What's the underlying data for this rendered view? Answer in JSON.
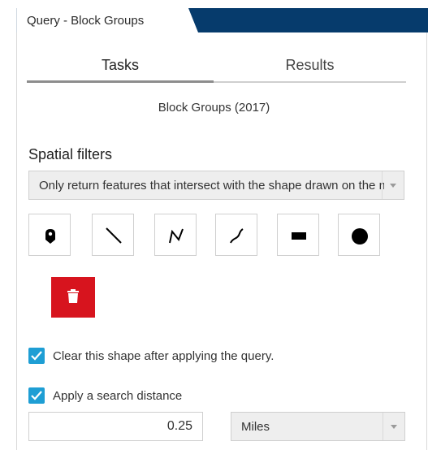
{
  "panel": {
    "title": "Query - Block Groups"
  },
  "tabs": [
    {
      "label": "Tasks"
    },
    {
      "label": "Results"
    }
  ],
  "layer": {
    "name": "Block Groups (2017)"
  },
  "spatial_filters": {
    "title": "Spatial filters",
    "selected": "Only return features that intersect with the shape drawn on the map"
  },
  "draw_tools": [
    {
      "icon": "map-pin-icon"
    },
    {
      "icon": "line-icon"
    },
    {
      "icon": "polyline-icon"
    },
    {
      "icon": "freehand-line-icon"
    },
    {
      "icon": "rectangle-icon"
    },
    {
      "icon": "circle-icon"
    }
  ],
  "clear_button": {
    "icon": "trash-icon",
    "color": "#d7141e"
  },
  "options": {
    "clear_shape_label": "Clear this shape after applying the query.",
    "clear_shape_checked": true,
    "search_distance_label": "Apply a search distance",
    "search_distance_checked": true,
    "distance_value": "0.25",
    "units": "Miles"
  },
  "colors": {
    "header": "#063b6c",
    "accent": "#1e9ed4"
  }
}
